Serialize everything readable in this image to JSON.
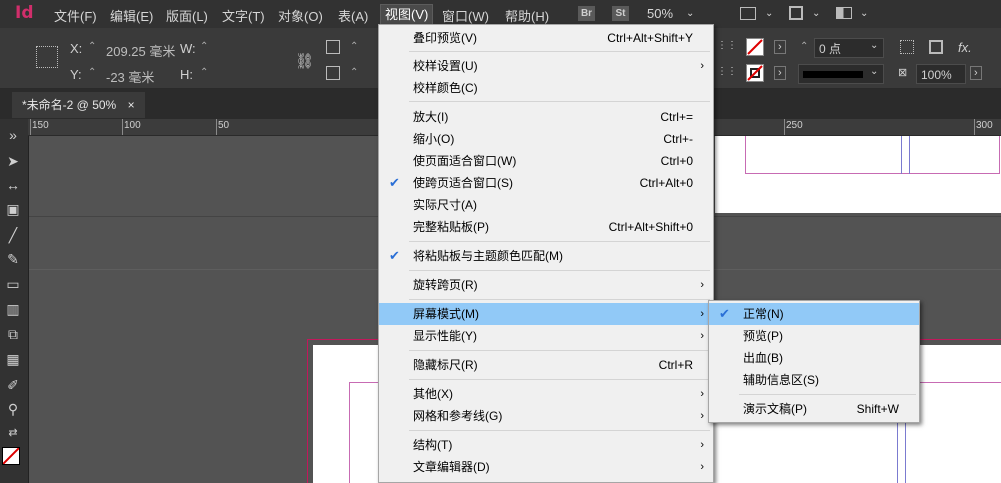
{
  "app": {
    "logo": "Id"
  },
  "menubar": {
    "items": [
      "文件(F)",
      "编辑(E)",
      "版面(L)",
      "文字(T)",
      "对象(O)",
      "表(A)",
      "视图(V)",
      "窗口(W)",
      "帮助(H)"
    ],
    "br": "Br",
    "st": "St",
    "zoom": "50%"
  },
  "control": {
    "x_label": "X:",
    "x_value": "209.25 毫米",
    "y_label": "Y:",
    "y_value": "-23 毫米",
    "w_label": "W:",
    "h_label": "H:",
    "stroke_weight": "0 点",
    "opacity": "100%"
  },
  "document_tab": {
    "label": "*未命名-2 @ 50%",
    "close": "×"
  },
  "ruler": {
    "labels": [
      "150",
      "100",
      "50",
      "250",
      "300"
    ]
  },
  "view_menu": {
    "items": [
      {
        "label": "叠印预览(V)",
        "shortcut": "Ctrl+Alt+Shift+Y"
      },
      {
        "label": "校样设置(U)",
        "submenu": true
      },
      {
        "label": "校样颜色(C)"
      },
      {
        "label": "放大(I)",
        "shortcut": "Ctrl+="
      },
      {
        "label": "缩小(O)",
        "shortcut": "Ctrl+-"
      },
      {
        "label": "使页面适合窗口(W)",
        "shortcut": "Ctrl+0"
      },
      {
        "label": "使跨页适合窗口(S)",
        "shortcut": "Ctrl+Alt+0",
        "checked": true
      },
      {
        "label": "实际尺寸(A)"
      },
      {
        "label": "完整粘贴板(P)",
        "shortcut": "Ctrl+Alt+Shift+0"
      },
      {
        "label": "将粘贴板与主题颜色匹配(M)",
        "checked": true
      },
      {
        "label": "旋转跨页(R)",
        "submenu": true
      },
      {
        "label": "屏幕模式(M)",
        "submenu": true,
        "highlighted": true
      },
      {
        "label": "显示性能(Y)",
        "submenu": true
      },
      {
        "label": "隐藏标尺(R)",
        "shortcut": "Ctrl+R"
      },
      {
        "label": "其他(X)",
        "submenu": true
      },
      {
        "label": "网格和参考线(G)",
        "submenu": true
      },
      {
        "label": "结构(T)",
        "submenu": true
      },
      {
        "label": "文章编辑器(D)",
        "submenu": true
      }
    ]
  },
  "screen_mode_menu": {
    "items": [
      {
        "label": "正常(N)",
        "checked": true,
        "highlighted": true
      },
      {
        "label": "预览(P)"
      },
      {
        "label": "出血(B)"
      },
      {
        "label": "辅助信息区(S)"
      },
      {
        "label": "演示文稿(P)",
        "shortcut": "Shift+W"
      }
    ]
  },
  "colors": {
    "accent_highlight": "#91c9f7",
    "menubar_bg": "#323232",
    "canvas_bg": "#535353",
    "logo": "#d12e6b"
  }
}
